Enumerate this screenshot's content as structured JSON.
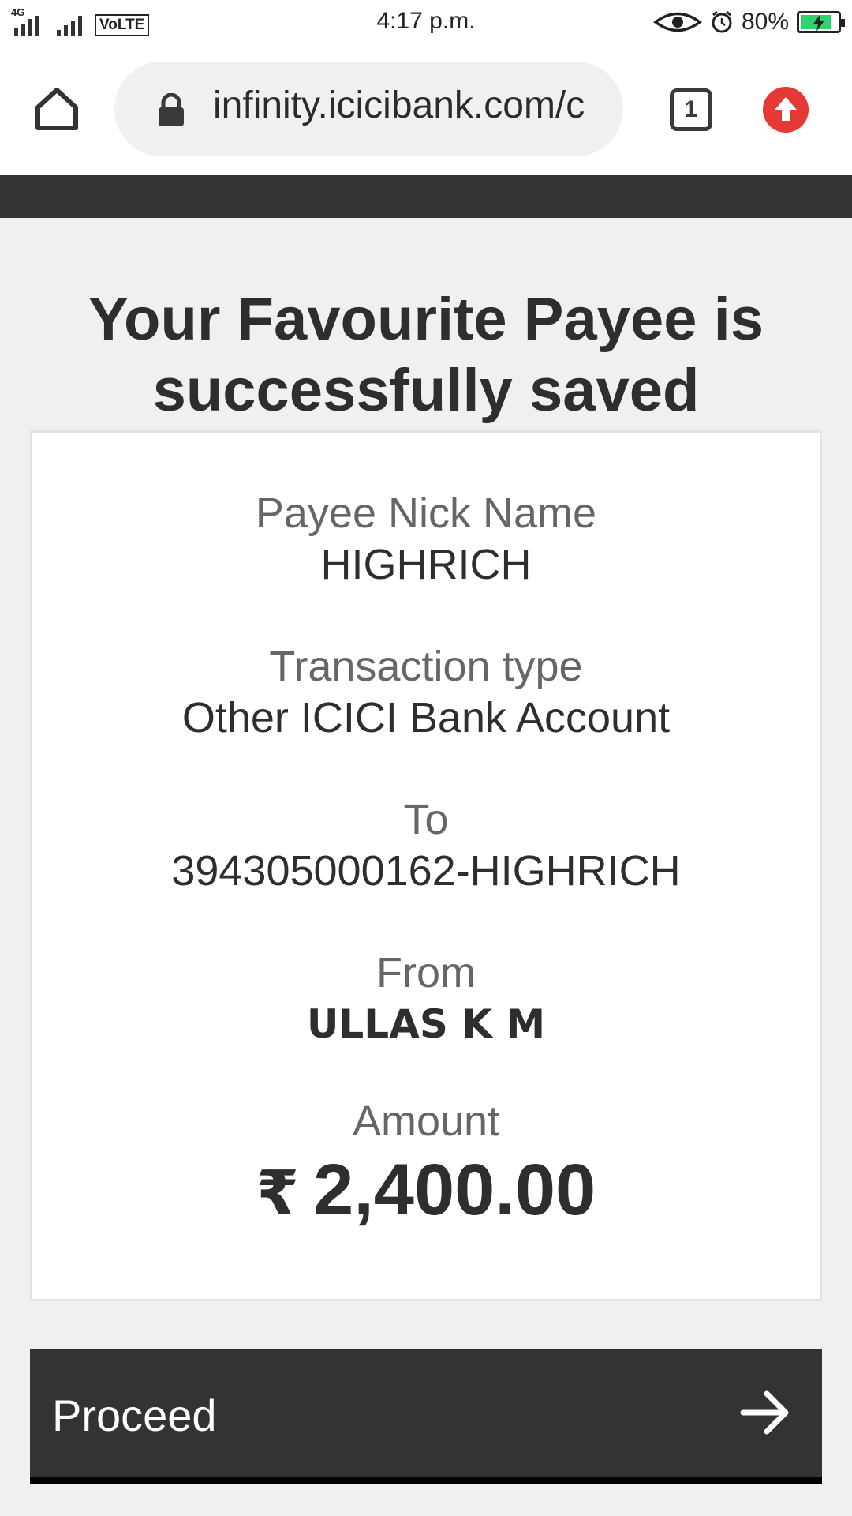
{
  "status_bar": {
    "network_label": "4G",
    "volte_label": "VoLTE",
    "time": "4:17 p.m.",
    "battery_percent": "80%",
    "battery_level": 0.8,
    "icons": [
      "signal-icon",
      "eye-icon",
      "alarm-icon",
      "battery-charging-icon"
    ]
  },
  "browser": {
    "url": "infinity.icicibank.com/c",
    "tab_count": "1",
    "icons": [
      "home-icon",
      "lock-icon",
      "tabs-icon",
      "update-icon"
    ],
    "accent_color": "#e53935"
  },
  "page": {
    "headline": "Your Favourite Payee is successfully saved",
    "payee_nick_name_label": "Payee Nick Name",
    "payee_nick_name": "HIGHRICH",
    "transaction_type_label": "Transaction type",
    "transaction_type": "Other ICICI Bank Account",
    "to_label": "To",
    "to_value": "394305000162-HIGHRICH",
    "from_label": "From",
    "from_value": "ULLAS K M",
    "amount_label": "Amount",
    "currency_symbol": "₹",
    "amount_value": "2,400.00",
    "proceed_label": "Proceed",
    "primary_color": "#333333"
  }
}
